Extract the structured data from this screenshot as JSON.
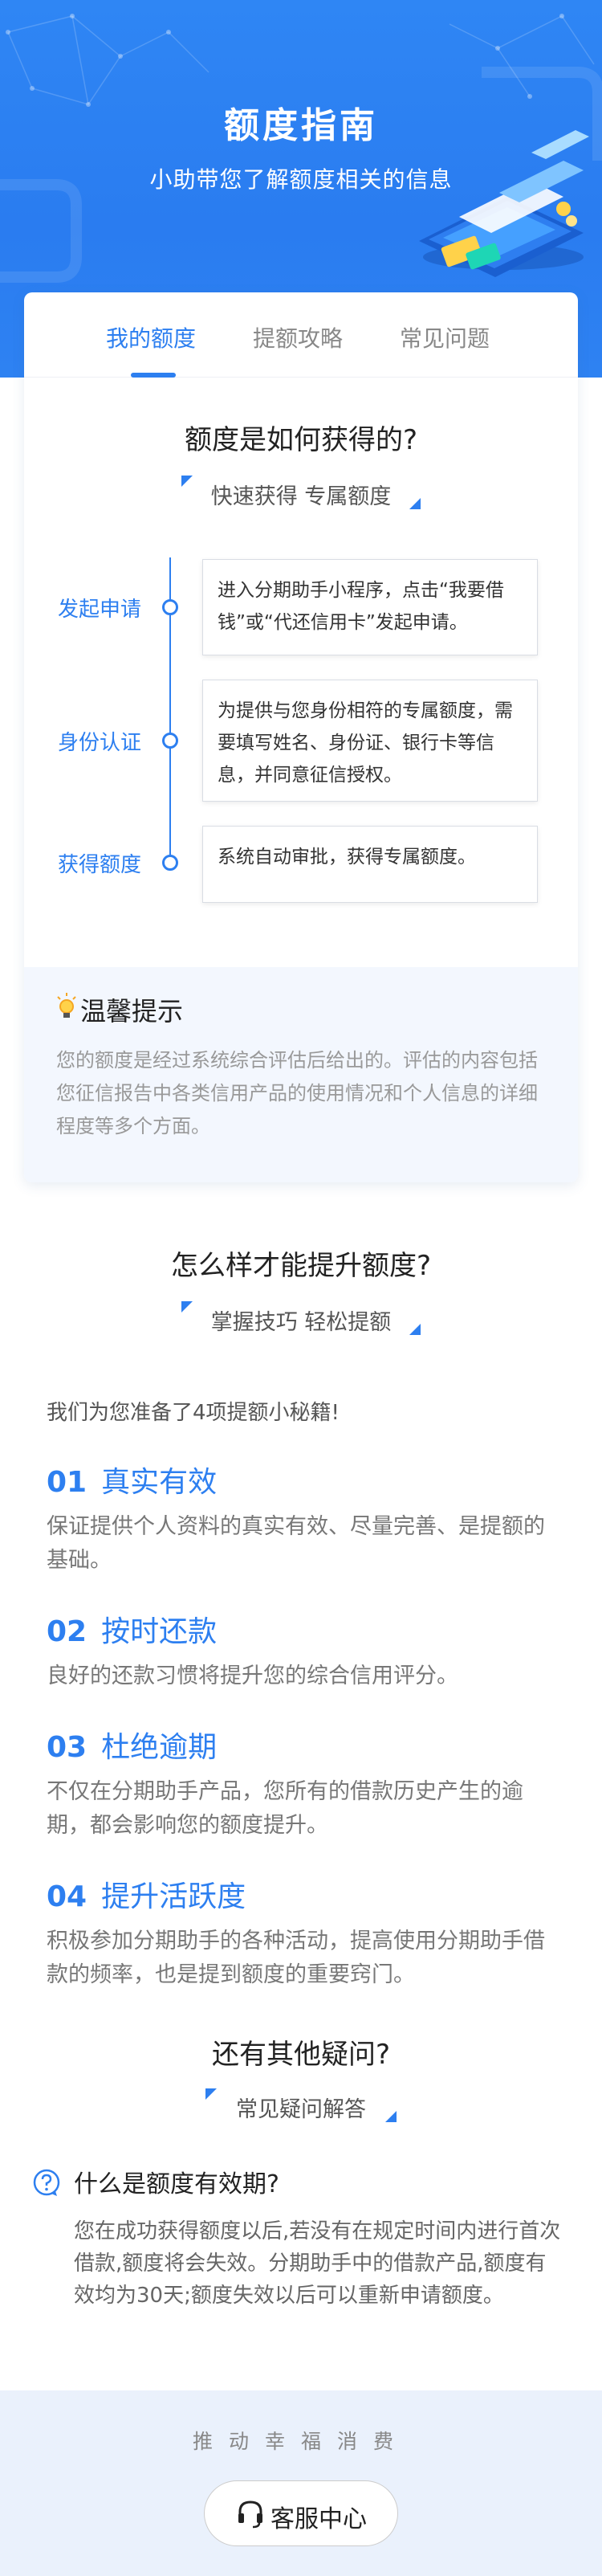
{
  "hero": {
    "title": "额度指南",
    "subtitle": "小助带您了解额度相关的信息"
  },
  "tabs": [
    {
      "label": "我的额度",
      "active": true
    },
    {
      "label": "提额攻略",
      "active": false
    },
    {
      "label": "常见问题",
      "active": false
    }
  ],
  "section1": {
    "title": "额度是如何获得的?",
    "subtitle": "快速获得 专属额度",
    "steps": [
      {
        "label": "发起申请",
        "text": "进入分期助手小程序，点击“我要借钱”或“代还信用卡”发起申请。"
      },
      {
        "label": "身份认证",
        "text": "为提供与您身份相符的专属额度，需要填写姓名、身份证、银行卡等信息，并同意征信授权。"
      },
      {
        "label": "获得额度",
        "text": "系统自动审批，获得专属额度。"
      }
    ],
    "tip": {
      "title": "温馨提示",
      "icon": "lightbulb-icon",
      "body": "您的额度是经过系统综合评估后给出的。评估的内容包括您征信报告中各类信用产品的使用情况和个人信息的详细程度等多个方面。"
    }
  },
  "section2": {
    "title": "怎么样才能提升额度?",
    "subtitle": "掌握技巧 轻松提额",
    "intro": "我们为您准备了4项提额小秘籍!",
    "items": [
      {
        "num": "01",
        "title": "真实有效",
        "body": "保证提供个人资料的真实有效、尽量完善、是提额的基础。"
      },
      {
        "num": "02",
        "title": "按时还款",
        "body": "良好的还款习惯将提升您的综合信用评分。"
      },
      {
        "num": "03",
        "title": "杜绝逾期",
        "body": "不仅在分期助手产品，您所有的借款历史产生的逾期，都会影响您的额度提升。"
      },
      {
        "num": "04",
        "title": "提升活跃度",
        "body": "积极参加分期助手的各种活动，提高使用分期助手借款的频率，也是提到额度的重要窍门。"
      }
    ]
  },
  "section3": {
    "title": "还有其他疑问?",
    "subtitle": "常见疑问解答",
    "faq": {
      "question": "什么是额度有效期?",
      "answer": "您在成功获得额度以后,若没有在规定时间内进行首次借款,额度将会失效。分期助手中的借款产品,额度有效均为30天;额度失效以后可以重新申请额度。"
    }
  },
  "footer": {
    "slogan": "推动幸福消费",
    "service_button": "客服中心"
  },
  "colors": {
    "primary": "#2d7ff0",
    "hero_bg": "#2f86f4",
    "footer_bg": "#eaf1fc",
    "tip_bg": "#f3f7fe"
  }
}
